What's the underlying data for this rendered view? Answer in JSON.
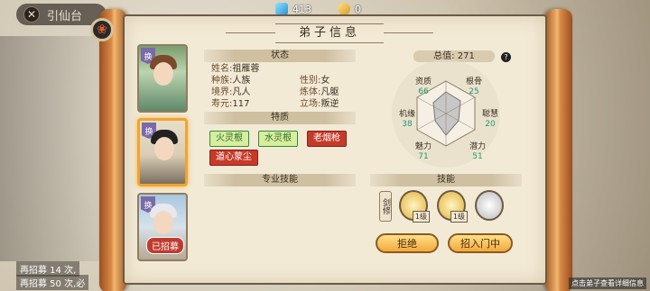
{
  "topbar": {
    "title": "引仙台",
    "close_icon": "close-icon"
  },
  "resources": {
    "crystal": "413",
    "coin": "0"
  },
  "panel": {
    "title": "弟子信息"
  },
  "sections": {
    "status": "状态",
    "traits": "特质",
    "pro_skills": "专业技能",
    "skills": "技能"
  },
  "portraits": [
    {
      "tag": "换"
    },
    {
      "tag": "换"
    },
    {
      "tag": "换",
      "badge": "已招募"
    }
  ],
  "info": {
    "name_label": "姓名:",
    "name": "祖雁蓉",
    "gender_label": "性别:",
    "gender": "女",
    "race_label": "种族:",
    "race": "人族",
    "body_label": "炼体:",
    "body": "凡躯",
    "realm_label": "境界:",
    "realm": "凡人",
    "stance_label": "立场:",
    "stance": "叛逆",
    "life_label": "寿元:",
    "life": "117"
  },
  "traits": [
    {
      "label": "火灵根",
      "color": "#2e8b3c"
    },
    {
      "label": "水灵根",
      "color": "#2e8b3c"
    },
    {
      "label": "老烟枪",
      "color": "#c63a2a"
    },
    {
      "label": "道心蒙尘",
      "color": "#c63a2a"
    }
  ],
  "stats": {
    "total_label": "总值:",
    "total": "271",
    "help": "?",
    "items": [
      {
        "label": "资质",
        "value": "66"
      },
      {
        "label": "根骨",
        "value": "25"
      },
      {
        "label": "聪慧",
        "value": "20"
      },
      {
        "label": "潜力",
        "value": "51"
      },
      {
        "label": "魅力",
        "value": "71"
      },
      {
        "label": "机缘",
        "value": "38"
      }
    ]
  },
  "skills": {
    "label": "剑修",
    "levels": [
      "1级",
      "1级"
    ]
  },
  "buttons": {
    "reject": "拒绝",
    "recruit": "招入门中"
  },
  "footer": {
    "line1": "再招募 14 次,",
    "line2": "再招募 50 次,必",
    "hint": "点击弟子查看详细信息"
  }
}
